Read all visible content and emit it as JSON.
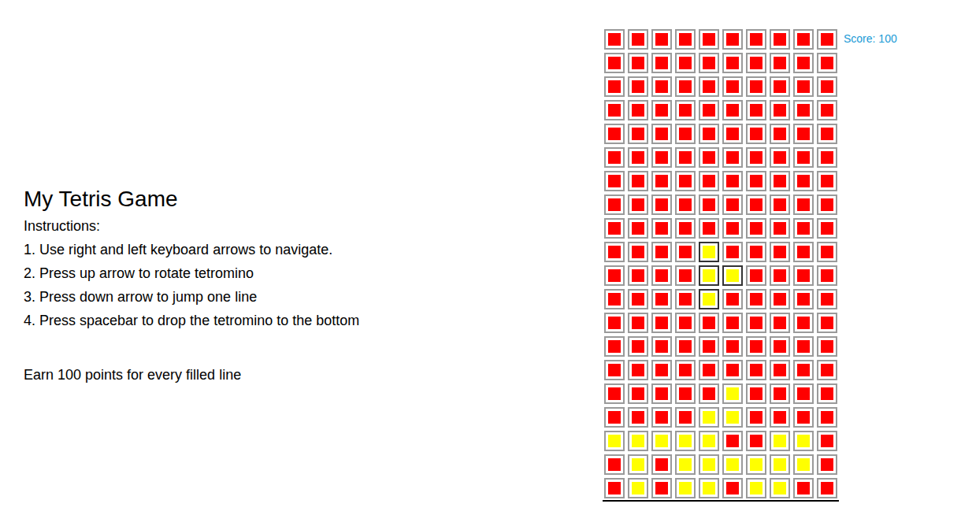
{
  "title": "My Tetris Game",
  "instructions_heading": "Instructions:",
  "instructions": [
    "1. Use right and left keyboard arrows to navigate.",
    "2. Press up arrow to rotate tetromino",
    "3. Press down arrow to jump one line",
    "4. Press spacebar to drop the tetromino to the bottom"
  ],
  "note": "Earn 100 points for every filled line",
  "score": "Score: 100",
  "board": {
    "rows": [
      [
        {
          "color": "#ff0000",
          "active": false
        },
        {
          "color": "#ff0000",
          "active": false
        },
        {
          "color": "#ff0000",
          "active": false
        },
        {
          "color": "#ff0000",
          "active": false
        },
        {
          "color": "#ff0000",
          "active": false
        },
        {
          "color": "#ff0000",
          "active": false
        },
        {
          "color": "#ff0000",
          "active": false
        },
        {
          "color": "#ff0000",
          "active": false
        },
        {
          "color": "#ff0000",
          "active": false
        },
        {
          "color": "#ff0000",
          "active": false
        }
      ],
      [
        {
          "color": "#ff0000",
          "active": false
        },
        {
          "color": "#ff0000",
          "active": false
        },
        {
          "color": "#ff0000",
          "active": false
        },
        {
          "color": "#ff0000",
          "active": false
        },
        {
          "color": "#ff0000",
          "active": false
        },
        {
          "color": "#ff0000",
          "active": false
        },
        {
          "color": "#ff0000",
          "active": false
        },
        {
          "color": "#ff0000",
          "active": false
        },
        {
          "color": "#ff0000",
          "active": false
        },
        {
          "color": "#ff0000",
          "active": false
        }
      ],
      [
        {
          "color": "#ff0000",
          "active": false
        },
        {
          "color": "#ff0000",
          "active": false
        },
        {
          "color": "#ff0000",
          "active": false
        },
        {
          "color": "#ff0000",
          "active": false
        },
        {
          "color": "#ff0000",
          "active": false
        },
        {
          "color": "#ff0000",
          "active": false
        },
        {
          "color": "#ff0000",
          "active": false
        },
        {
          "color": "#ff0000",
          "active": false
        },
        {
          "color": "#ff0000",
          "active": false
        },
        {
          "color": "#ff0000",
          "active": false
        }
      ],
      [
        {
          "color": "#ff0000",
          "active": false
        },
        {
          "color": "#ff0000",
          "active": false
        },
        {
          "color": "#ff0000",
          "active": false
        },
        {
          "color": "#ff0000",
          "active": false
        },
        {
          "color": "#ff0000",
          "active": false
        },
        {
          "color": "#ff0000",
          "active": false
        },
        {
          "color": "#ff0000",
          "active": false
        },
        {
          "color": "#ff0000",
          "active": false
        },
        {
          "color": "#ff0000",
          "active": false
        },
        {
          "color": "#ff0000",
          "active": false
        }
      ],
      [
        {
          "color": "#ff0000",
          "active": false
        },
        {
          "color": "#ff0000",
          "active": false
        },
        {
          "color": "#ff0000",
          "active": false
        },
        {
          "color": "#ff0000",
          "active": false
        },
        {
          "color": "#ff0000",
          "active": false
        },
        {
          "color": "#ff0000",
          "active": false
        },
        {
          "color": "#ff0000",
          "active": false
        },
        {
          "color": "#ff0000",
          "active": false
        },
        {
          "color": "#ff0000",
          "active": false
        },
        {
          "color": "#ff0000",
          "active": false
        }
      ],
      [
        {
          "color": "#ff0000",
          "active": false
        },
        {
          "color": "#ff0000",
          "active": false
        },
        {
          "color": "#ff0000",
          "active": false
        },
        {
          "color": "#ff0000",
          "active": false
        },
        {
          "color": "#ff0000",
          "active": false
        },
        {
          "color": "#ff0000",
          "active": false
        },
        {
          "color": "#ff0000",
          "active": false
        },
        {
          "color": "#ff0000",
          "active": false
        },
        {
          "color": "#ff0000",
          "active": false
        },
        {
          "color": "#ff0000",
          "active": false
        }
      ],
      [
        {
          "color": "#ff0000",
          "active": false
        },
        {
          "color": "#ff0000",
          "active": false
        },
        {
          "color": "#ff0000",
          "active": false
        },
        {
          "color": "#ff0000",
          "active": false
        },
        {
          "color": "#ff0000",
          "active": false
        },
        {
          "color": "#ff0000",
          "active": false
        },
        {
          "color": "#ff0000",
          "active": false
        },
        {
          "color": "#ff0000",
          "active": false
        },
        {
          "color": "#ff0000",
          "active": false
        },
        {
          "color": "#ff0000",
          "active": false
        }
      ],
      [
        {
          "color": "#ff0000",
          "active": false
        },
        {
          "color": "#ff0000",
          "active": false
        },
        {
          "color": "#ff0000",
          "active": false
        },
        {
          "color": "#ff0000",
          "active": false
        },
        {
          "color": "#ff0000",
          "active": false
        },
        {
          "color": "#ff0000",
          "active": false
        },
        {
          "color": "#ff0000",
          "active": false
        },
        {
          "color": "#ff0000",
          "active": false
        },
        {
          "color": "#ff0000",
          "active": false
        },
        {
          "color": "#ff0000",
          "active": false
        }
      ],
      [
        {
          "color": "#ff0000",
          "active": false
        },
        {
          "color": "#ff0000",
          "active": false
        },
        {
          "color": "#ff0000",
          "active": false
        },
        {
          "color": "#ff0000",
          "active": false
        },
        {
          "color": "#ff0000",
          "active": false
        },
        {
          "color": "#ff0000",
          "active": false
        },
        {
          "color": "#ff0000",
          "active": false
        },
        {
          "color": "#ff0000",
          "active": false
        },
        {
          "color": "#ff0000",
          "active": false
        },
        {
          "color": "#ff0000",
          "active": false
        }
      ],
      [
        {
          "color": "#ff0000",
          "active": false
        },
        {
          "color": "#ff0000",
          "active": false
        },
        {
          "color": "#ff0000",
          "active": false
        },
        {
          "color": "#ff0000",
          "active": false
        },
        {
          "color": "#ffff00",
          "active": true
        },
        {
          "color": "#ff0000",
          "active": false
        },
        {
          "color": "#ff0000",
          "active": false
        },
        {
          "color": "#ff0000",
          "active": false
        },
        {
          "color": "#ff0000",
          "active": false
        },
        {
          "color": "#ff0000",
          "active": false
        }
      ],
      [
        {
          "color": "#ff0000",
          "active": false
        },
        {
          "color": "#ff0000",
          "active": false
        },
        {
          "color": "#ff0000",
          "active": false
        },
        {
          "color": "#ff0000",
          "active": false
        },
        {
          "color": "#ffff00",
          "active": true
        },
        {
          "color": "#ffff00",
          "active": true
        },
        {
          "color": "#ff0000",
          "active": false
        },
        {
          "color": "#ff0000",
          "active": false
        },
        {
          "color": "#ff0000",
          "active": false
        },
        {
          "color": "#ff0000",
          "active": false
        }
      ],
      [
        {
          "color": "#ff0000",
          "active": false
        },
        {
          "color": "#ff0000",
          "active": false
        },
        {
          "color": "#ff0000",
          "active": false
        },
        {
          "color": "#ff0000",
          "active": false
        },
        {
          "color": "#ffff00",
          "active": true
        },
        {
          "color": "#ff0000",
          "active": false
        },
        {
          "color": "#ff0000",
          "active": false
        },
        {
          "color": "#ff0000",
          "active": false
        },
        {
          "color": "#ff0000",
          "active": false
        },
        {
          "color": "#ff0000",
          "active": false
        }
      ],
      [
        {
          "color": "#ff0000",
          "active": false
        },
        {
          "color": "#ff0000",
          "active": false
        },
        {
          "color": "#ff0000",
          "active": false
        },
        {
          "color": "#ff0000",
          "active": false
        },
        {
          "color": "#ff0000",
          "active": false
        },
        {
          "color": "#ff0000",
          "active": false
        },
        {
          "color": "#ff0000",
          "active": false
        },
        {
          "color": "#ff0000",
          "active": false
        },
        {
          "color": "#ff0000",
          "active": false
        },
        {
          "color": "#ff0000",
          "active": false
        }
      ],
      [
        {
          "color": "#ff0000",
          "active": false
        },
        {
          "color": "#ff0000",
          "active": false
        },
        {
          "color": "#ff0000",
          "active": false
        },
        {
          "color": "#ff0000",
          "active": false
        },
        {
          "color": "#ff0000",
          "active": false
        },
        {
          "color": "#ff0000",
          "active": false
        },
        {
          "color": "#ff0000",
          "active": false
        },
        {
          "color": "#ff0000",
          "active": false
        },
        {
          "color": "#ff0000",
          "active": false
        },
        {
          "color": "#ff0000",
          "active": false
        }
      ],
      [
        {
          "color": "#ff0000",
          "active": false
        },
        {
          "color": "#ff0000",
          "active": false
        },
        {
          "color": "#ff0000",
          "active": false
        },
        {
          "color": "#ff0000",
          "active": false
        },
        {
          "color": "#ff0000",
          "active": false
        },
        {
          "color": "#ff0000",
          "active": false
        },
        {
          "color": "#ff0000",
          "active": false
        },
        {
          "color": "#ff0000",
          "active": false
        },
        {
          "color": "#ff0000",
          "active": false
        },
        {
          "color": "#ff0000",
          "active": false
        }
      ],
      [
        {
          "color": "#ff0000",
          "active": false
        },
        {
          "color": "#ff0000",
          "active": false
        },
        {
          "color": "#ff0000",
          "active": false
        },
        {
          "color": "#ff0000",
          "active": false
        },
        {
          "color": "#ff0000",
          "active": false
        },
        {
          "color": "#ffff00",
          "active": false
        },
        {
          "color": "#ff0000",
          "active": false
        },
        {
          "color": "#ff0000",
          "active": false
        },
        {
          "color": "#ff0000",
          "active": false
        },
        {
          "color": "#ff0000",
          "active": false
        }
      ],
      [
        {
          "color": "#ff0000",
          "active": false
        },
        {
          "color": "#ff0000",
          "active": false
        },
        {
          "color": "#ff0000",
          "active": false
        },
        {
          "color": "#ff0000",
          "active": false
        },
        {
          "color": "#ffff00",
          "active": false
        },
        {
          "color": "#ffff00",
          "active": false
        },
        {
          "color": "#ff0000",
          "active": false
        },
        {
          "color": "#ff0000",
          "active": false
        },
        {
          "color": "#ff0000",
          "active": false
        },
        {
          "color": "#ff0000",
          "active": false
        }
      ],
      [
        {
          "color": "#ffff00",
          "active": false
        },
        {
          "color": "#ffff00",
          "active": false
        },
        {
          "color": "#ffff00",
          "active": false
        },
        {
          "color": "#ffff00",
          "active": false
        },
        {
          "color": "#ffff00",
          "active": false
        },
        {
          "color": "#ff0000",
          "active": false
        },
        {
          "color": "#ff0000",
          "active": false
        },
        {
          "color": "#ffff00",
          "active": false
        },
        {
          "color": "#ffff00",
          "active": false
        },
        {
          "color": "#ff0000",
          "active": false
        }
      ],
      [
        {
          "color": "#ff0000",
          "active": false
        },
        {
          "color": "#ffff00",
          "active": false
        },
        {
          "color": "#ff0000",
          "active": false
        },
        {
          "color": "#ffff00",
          "active": false
        },
        {
          "color": "#ffff00",
          "active": false
        },
        {
          "color": "#ffff00",
          "active": false
        },
        {
          "color": "#ffff00",
          "active": false
        },
        {
          "color": "#ffff00",
          "active": false
        },
        {
          "color": "#ffff00",
          "active": false
        },
        {
          "color": "#ff0000",
          "active": false
        }
      ],
      [
        {
          "color": "#ff0000",
          "active": false
        },
        {
          "color": "#ffff00",
          "active": false
        },
        {
          "color": "#ff0000",
          "active": false
        },
        {
          "color": "#ffff00",
          "active": false
        },
        {
          "color": "#ffff00",
          "active": false
        },
        {
          "color": "#ff0000",
          "active": false
        },
        {
          "color": "#ffff00",
          "active": false
        },
        {
          "color": "#ffff00",
          "active": false
        },
        {
          "color": "#ff0000",
          "active": false
        },
        {
          "color": "#ff0000",
          "active": false
        }
      ]
    ]
  }
}
